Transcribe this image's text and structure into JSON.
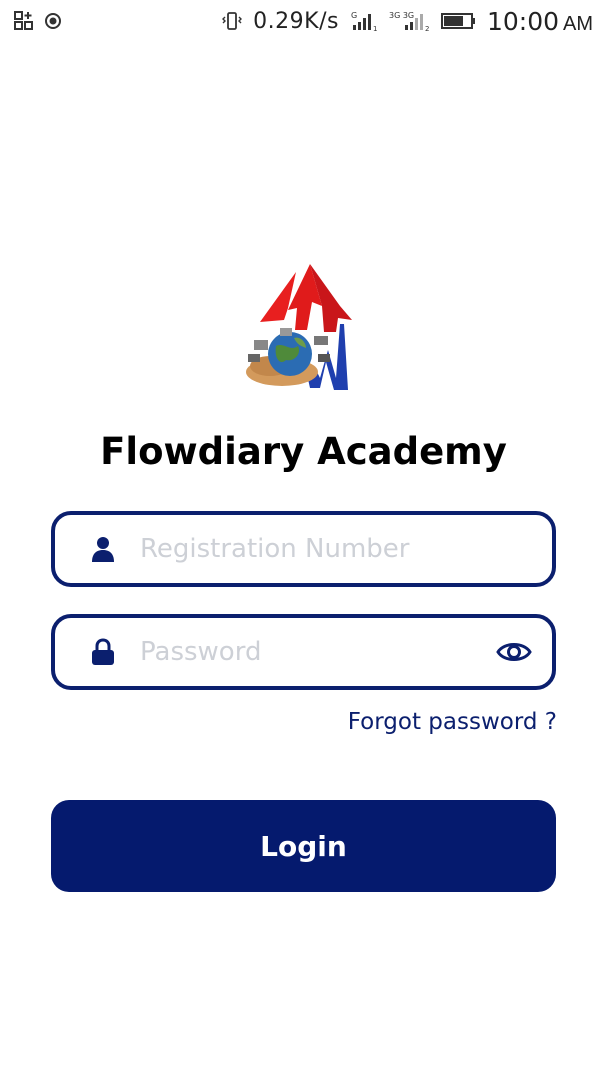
{
  "status_bar": {
    "network_speed": "0.29K/s",
    "time": "10:00",
    "ampm": "AM",
    "sim1_label": "G",
    "sim2_label": "3G 3G"
  },
  "app": {
    "title": "Flowdiary Academy"
  },
  "form": {
    "registration_placeholder": "Registration Number",
    "registration_value": "",
    "password_placeholder": "Password",
    "password_value": "",
    "forgot_password_label": "Forgot password ?",
    "login_label": "Login"
  },
  "colors": {
    "primary": "#051a6e",
    "border": "#0b1f6e",
    "placeholder": "#cdd0d6"
  },
  "icons": {
    "user": "user-icon",
    "lock": "lock-icon",
    "eye": "eye-icon"
  }
}
